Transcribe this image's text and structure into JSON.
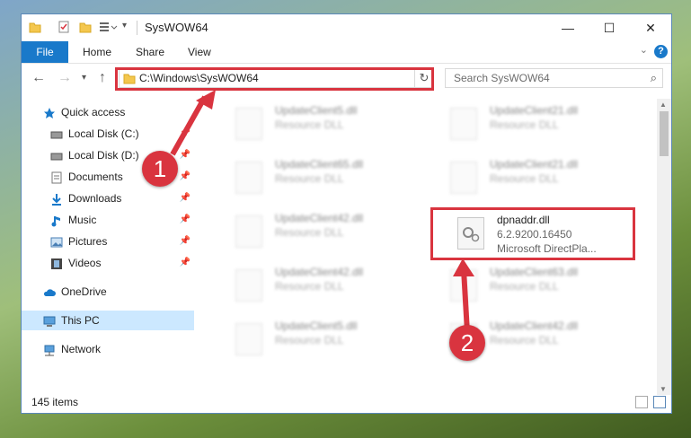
{
  "window": {
    "title": "SysWOW64"
  },
  "ribbon": {
    "tabs": [
      "File",
      "Home",
      "Share",
      "View"
    ],
    "help": "?"
  },
  "address": {
    "path": "C:\\Windows\\SysWOW64",
    "refresh": "↻"
  },
  "search": {
    "placeholder": "Search SysWOW64"
  },
  "sidebar": {
    "items": [
      {
        "label": "Quick access"
      },
      {
        "label": "Local Disk (C:)"
      },
      {
        "label": "Local Disk (D:)"
      },
      {
        "label": "Documents"
      },
      {
        "label": "Downloads"
      },
      {
        "label": "Music"
      },
      {
        "label": "Pictures"
      },
      {
        "label": "Videos"
      },
      {
        "label": "OneDrive"
      },
      {
        "label": "This PC"
      },
      {
        "label": "Network"
      }
    ]
  },
  "files": [
    {
      "name": "UpdateClient5.dll",
      "desc": "Resource DLL"
    },
    {
      "name": "UpdateClient21.dll",
      "desc": "Resource DLL"
    },
    {
      "name": "UpdateClient65.dll",
      "desc": "Resource DLL"
    },
    {
      "name": "UpdateClient21.dll",
      "desc": "Resource DLL"
    },
    {
      "name": "UpdateClient42.dll",
      "desc": "Resource DLL"
    },
    {
      "name": "dpnaddr.dll",
      "desc": "6.2.9200.16450",
      "desc2": "Microsoft DirectPla..."
    },
    {
      "name": "UpdateClient42.dll",
      "desc": "Resource DLL"
    },
    {
      "name": "UpdateClient63.dll",
      "desc": "Resource DLL"
    },
    {
      "name": "UpdateClient5.dll",
      "desc": "Resource DLL"
    },
    {
      "name": "UpdateClient42.dll",
      "desc": "Resource DLL"
    }
  ],
  "status": {
    "count": "145 items"
  },
  "annotations": {
    "step1": "1",
    "step2": "2"
  },
  "colors": {
    "accent": "#1979ca",
    "highlight": "#d9343f",
    "selected": "#cce8ff"
  }
}
